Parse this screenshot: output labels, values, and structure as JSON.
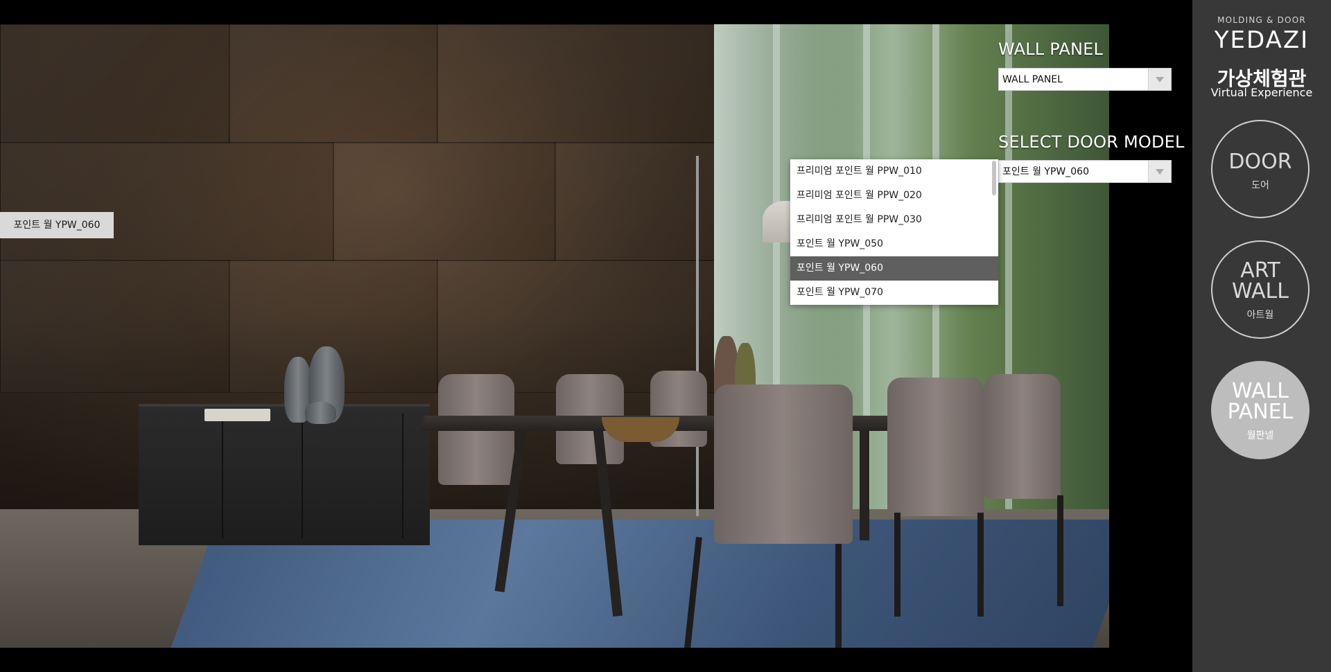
{
  "scene_tag": {
    "label": "포인트 월 YPW_060"
  },
  "wall_panel": {
    "title": "WALL PANEL",
    "selected": "WALL PANEL"
  },
  "door_model": {
    "title": "SELECT DOOR MODEL",
    "selected": "포인트 월 YPW_060",
    "options": [
      "프리미엄 포인트 월 PPW_010",
      "프리미엄 포인트 월 PPW_020",
      "프리미엄 포인트 월 PPW_030",
      "포인트 월 YPW_050",
      "포인트 월 YPW_060",
      "포인트 월 YPW_070"
    ],
    "highlighted_index": 4
  },
  "sidebar": {
    "brand_tagline": "MOLDING & DOOR",
    "brand_name": "YEDAZI",
    "title_kr": "가상체험관",
    "title_en": "Virtual Experience",
    "nav": [
      {
        "en": [
          "DOOR"
        ],
        "kr": "도어",
        "active": false
      },
      {
        "en": [
          "ART",
          "WALL"
        ],
        "kr": "아트월",
        "active": false
      },
      {
        "en": [
          "WALL",
          "PANEL"
        ],
        "kr": "월판넬",
        "active": true
      }
    ]
  },
  "colors": {
    "sidebar_bg": "#383838",
    "nav_active_bg": "#bdbdbd",
    "dropdown_highlight": "#5f5f5f"
  }
}
